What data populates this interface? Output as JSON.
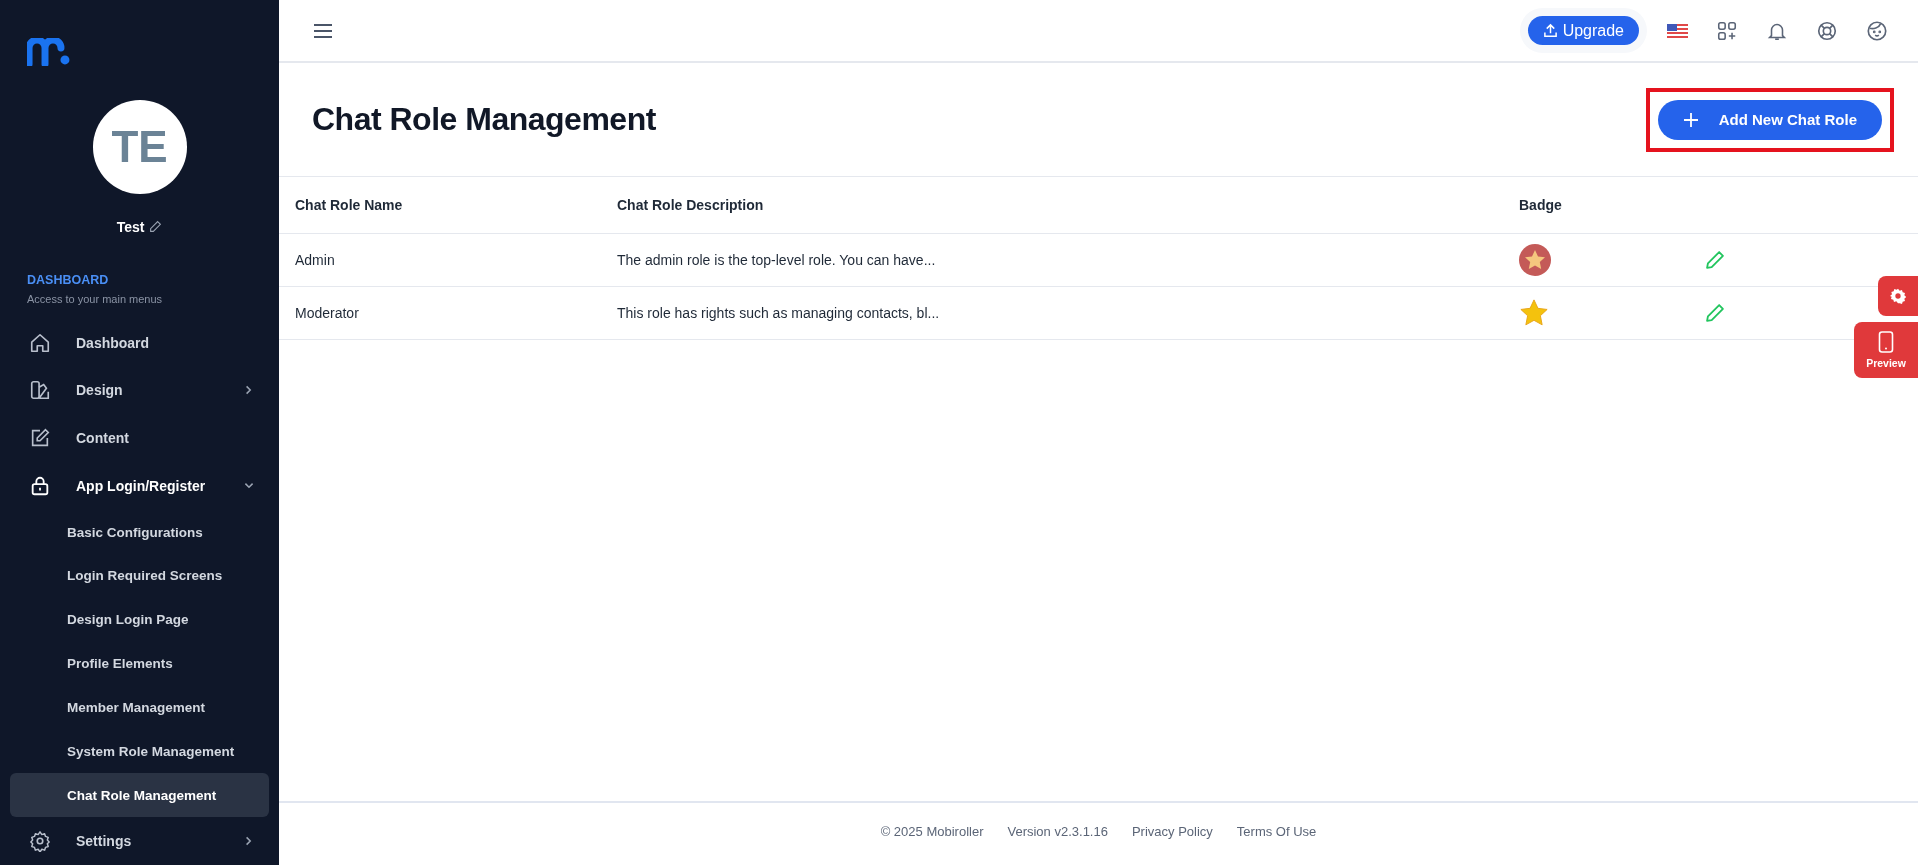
{
  "sidebar": {
    "avatar_initials": "TE",
    "user_name": "Test",
    "section_title": "DASHBOARD",
    "section_subtitle": "Access to your main menus",
    "items": [
      {
        "label": "Dashboard",
        "selected": false
      },
      {
        "label": "Design",
        "expanded": false,
        "selected": false
      },
      {
        "label": "Content",
        "selected": false
      },
      {
        "label": "App Login/Register",
        "expanded": true,
        "selected": false,
        "children": [
          {
            "label": "Basic Configurations",
            "selected": false
          },
          {
            "label": "Login Required Screens",
            "selected": false
          },
          {
            "label": "Design Login Page",
            "selected": false
          },
          {
            "label": "Profile Elements",
            "selected": false
          },
          {
            "label": "Member Management",
            "selected": false
          },
          {
            "label": "System Role Management",
            "selected": false
          },
          {
            "label": "Chat Role Management",
            "selected": true
          }
        ]
      },
      {
        "label": "Settings",
        "expanded": false,
        "selected": false
      }
    ]
  },
  "topbar": {
    "upgrade_label": "Upgrade"
  },
  "page": {
    "title": "Chat Role Management",
    "add_button": {
      "label": "Add New Chat Role",
      "highlighted": true
    }
  },
  "table": {
    "columns": [
      "Chat Role Name",
      "Chat Role Description",
      "Badge"
    ],
    "rows": [
      {
        "name": "Admin",
        "description": "The admin role is the top-level role. You can have...",
        "kind": "circle-star"
      },
      {
        "name": "Moderator",
        "description": "This role has rights such as managing contacts, bl...",
        "kind": "star"
      }
    ]
  },
  "floating": {
    "preview_label": "Preview"
  },
  "footer": [
    "© 2025 Mobiroller",
    "Version v2.3.1.16",
    "Privacy Policy",
    "Terms Of Use"
  ]
}
